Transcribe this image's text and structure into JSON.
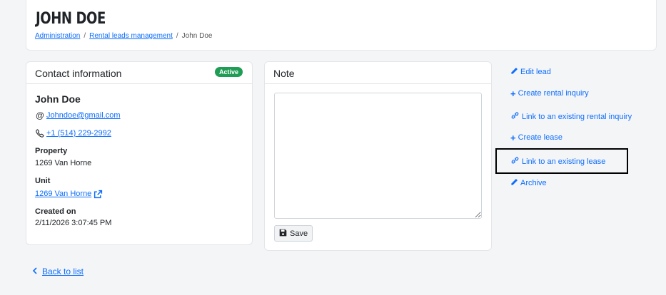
{
  "header": {
    "title": "JOHN DOE",
    "breadcrumb": [
      "Administration",
      "Rental leads management",
      "John Doe"
    ],
    "breadcrumb_separator": "/"
  },
  "contact": {
    "title": "Contact information",
    "status": "Active",
    "status_color": "#1f9d55",
    "name": "John Doe",
    "email": "Johndoe@gmail.com",
    "phone": "+1 (514) 229-2992",
    "property_label": "Property",
    "property_value": "1269 Van Horne",
    "unit_label": "Unit",
    "unit_value": "1269 Van Horne",
    "created_label": "Created on",
    "created_value": "2/11/2026 3:07:45 PM"
  },
  "note": {
    "title": "Note",
    "value": "",
    "save_label": "Save"
  },
  "actions": [
    {
      "icon": "pencil-icon",
      "label": "Edit lead"
    },
    {
      "icon": "plus-icon",
      "label": "Create rental inquiry"
    },
    {
      "icon": "link-icon",
      "label": "Link to an existing rental inquiry"
    },
    {
      "icon": "plus-icon",
      "label": "Create lease"
    },
    {
      "icon": "link-icon",
      "label": "Link to an existing lease"
    },
    {
      "icon": "pencil-icon",
      "label": "Archive"
    }
  ],
  "back": {
    "label": "Back to list"
  },
  "colors": {
    "link": "#0d6efd",
    "background": "#f4f5f7"
  }
}
